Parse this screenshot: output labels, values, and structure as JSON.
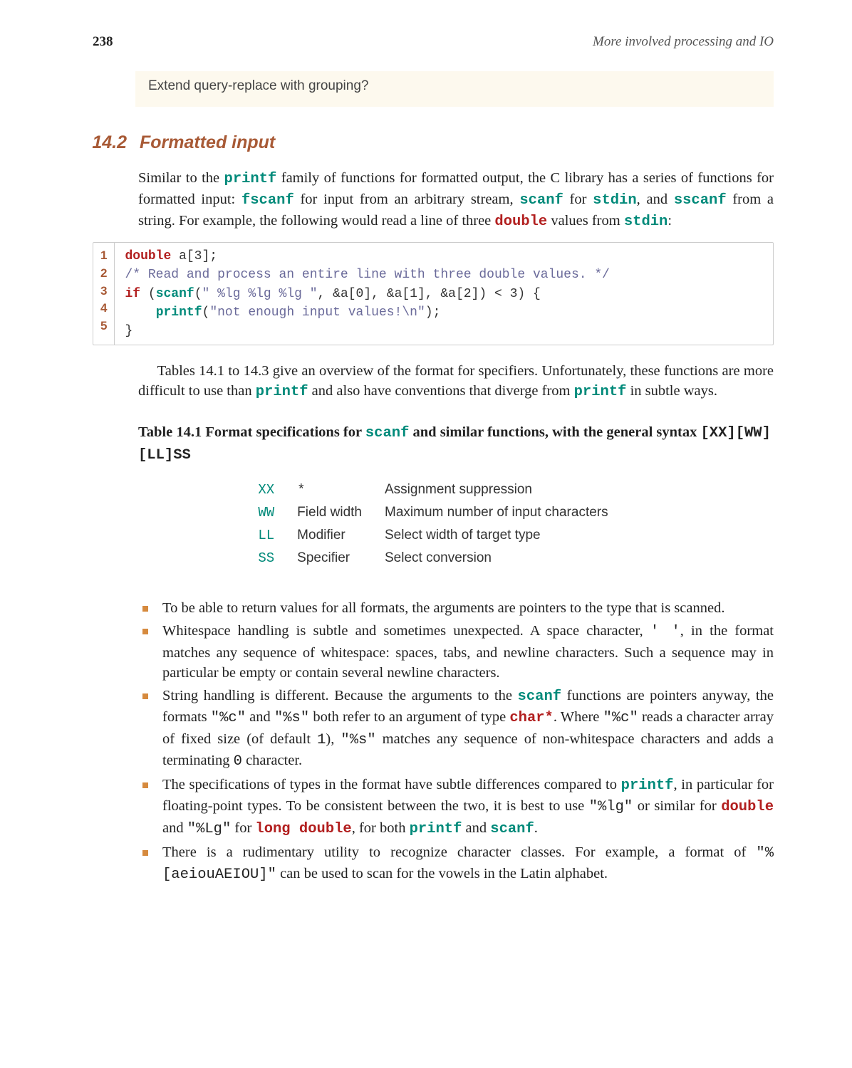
{
  "header": {
    "page_number": "238",
    "chapter": "More involved processing and IO"
  },
  "note": "Extend query-replace with grouping?",
  "section": {
    "number": "14.2",
    "title": "Formatted input"
  },
  "para1": {
    "t1": "Similar to the ",
    "printf": "printf",
    "t2": " family of functions for formatted output, the C library has a series of functions for formatted input: ",
    "fscanf": "fscanf",
    "t3": " for input from an arbitrary stream, ",
    "scanf": "scanf",
    "t4": " for ",
    "stdin": "stdin",
    "t5": ", and ",
    "sscanf": "sscanf",
    "t6": " from a string. For example, the following would read a line of three ",
    "double": "double",
    "t7": " values from ",
    "stdin2": "stdin",
    "t8": ":"
  },
  "code": {
    "ln": [
      "1",
      "2",
      "3",
      "4",
      "5"
    ],
    "l1_kw": "double",
    "l1_rest": " a[3];",
    "l2_cmt": "/* Read and process an entire line with three double values. */",
    "l3_if": "if",
    "l3_open": " (",
    "l3_scanf": "scanf",
    "l3_args_a": "(",
    "l3_str": "\" %lg %lg %lg \"",
    "l3_args_b": ", &a[0], &a[1], &a[2]) < 3) {",
    "l4_indent": "    ",
    "l4_printf": "printf",
    "l4_args_a": "(",
    "l4_str": "\"not enough input values!\\n\"",
    "l4_args_b": ");",
    "l5": "}"
  },
  "para2": {
    "t1": "Tables 14.1 to 14.3 give an overview of the format for specifiers. Unfortunately, these functions are more difficult to use than ",
    "printf": "printf",
    "t2": " and also have conventions that diverge from ",
    "printf2": "printf",
    "t3": " in subtle ways."
  },
  "table_caption": {
    "lead": "Table 14.1   Format specifications for ",
    "scanf": "scanf",
    "mid": " and similar functions, with the general syntax ",
    "syntax": "[XX][WW][LL]SS"
  },
  "table_rows": [
    {
      "c0": "XX",
      "c1": "*",
      "c2": "Assignment suppression"
    },
    {
      "c0": "WW",
      "c1": "Field width",
      "c2": "Maximum number of input characters"
    },
    {
      "c0": "LL",
      "c1": "Modifier",
      "c2": "Select width of target type"
    },
    {
      "c0": "SS",
      "c1": "Specifier",
      "c2": "Select conversion"
    }
  ],
  "bullets": {
    "b1": "To be able to return values for all formats, the arguments are pointers to the type that is scanned.",
    "b2": {
      "t1": "Whitespace handling is subtle and sometimes unexpected. A space character, ",
      "sp": "' '",
      "t2": ", in the format matches any sequence of whitespace: spaces, tabs, and newline characters. Such a sequence may in particular be empty or contain several newline characters."
    },
    "b3": {
      "t1": "String handling is different. Because the arguments to the ",
      "scanf": "scanf",
      "t2": " functions are pointers anyway, the formats ",
      "pc": "\"%c\"",
      "t3": " and ",
      "ps": "\"%s\"",
      "t4": " both refer to an argument of type ",
      "charstar": "char*",
      "t5": ". Where ",
      "pc2": "\"%c\"",
      "t6": " reads a character array of fixed size (of default ",
      "one": "1",
      "t7": "), ",
      "ps2": "\"%s\"",
      "t8": " matches any sequence of non-whitespace characters and adds a terminating ",
      "zero": "0",
      "t9": " character."
    },
    "b4": {
      "t1": "The specifications of types in the format have subtle differences compared to ",
      "printf": "printf",
      "t2": ", in particular for floating-point types. To be consistent between the two, it is best to use ",
      "lg": "\"%lg\"",
      "t3": " or similar for ",
      "double": "double",
      "t4": " and ",
      "Lg": "\"%Lg\"",
      "t5": " for ",
      "ldouble": "long double",
      "t6": ", for both ",
      "printf2": "printf",
      "t7": " and ",
      "scanf": "scanf",
      "t8": "."
    },
    "b5": {
      "t1": "There is a rudimentary utility to recognize character classes. For example, a format of ",
      "cls": "\"%[aeiouAEIOU]\"",
      "t2": " can be used to scan for the vowels in the Latin alphabet."
    }
  }
}
